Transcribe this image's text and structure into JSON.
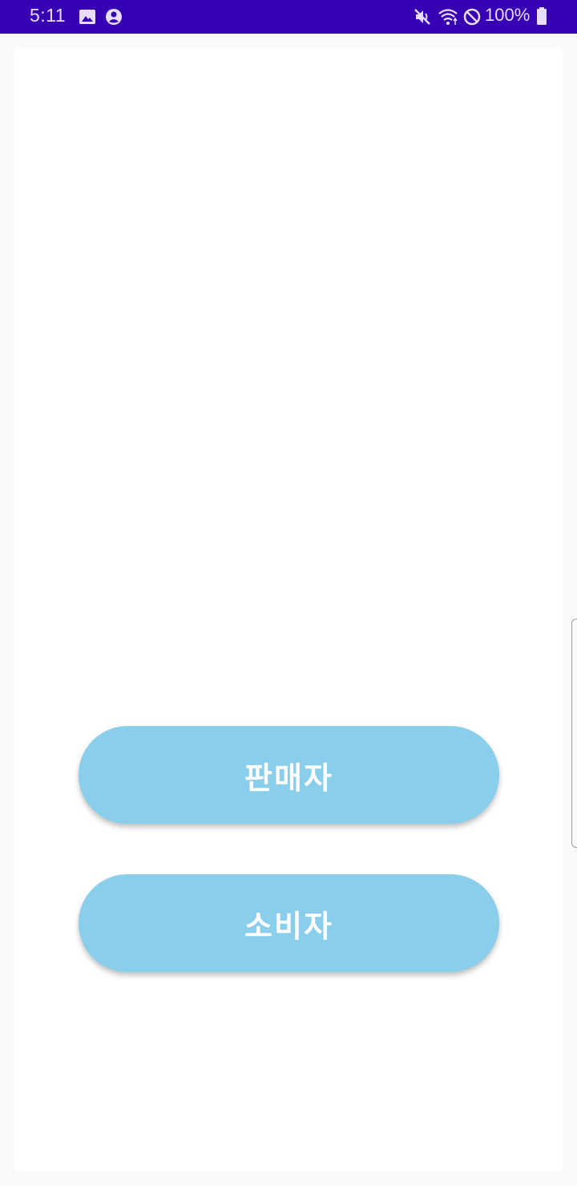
{
  "status_bar": {
    "time": "5:11",
    "battery": "100%",
    "icons": [
      "image-icon",
      "account-circle-icon",
      "mute-icon",
      "wifi-icon",
      "do-not-disturb-icon",
      "battery-icon"
    ],
    "background_color": "#3700b3"
  },
  "main": {
    "seller_label": "판매자",
    "buyer_label": "소비자",
    "button_color": "#89ceea"
  }
}
